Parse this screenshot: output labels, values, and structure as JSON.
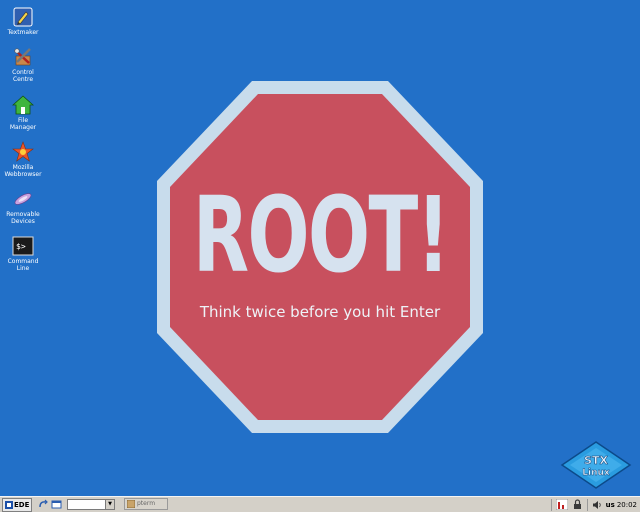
{
  "desktop": {
    "icons": [
      {
        "label": "Textmaker",
        "icon": "textmaker-icon"
      },
      {
        "label": "Control\nCentre",
        "icon": "control-centre-icon"
      },
      {
        "label": "File\nManager",
        "icon": "file-manager-icon"
      },
      {
        "label": "Mozilla\nWebbrowser",
        "icon": "mozilla-icon"
      },
      {
        "label": "Removable\nDevices",
        "icon": "removable-devices-icon"
      },
      {
        "label": "Command\nLine",
        "icon": "command-line-icon"
      }
    ]
  },
  "wallpaper": {
    "title": "ROOT!",
    "subtitle": "Think twice before you hit Enter",
    "logo_line1": "STX",
    "logo_line2": "Linux",
    "colors": {
      "background": "#2270c8",
      "sign_fill": "#c8505e",
      "sign_border": "#c8dcec"
    }
  },
  "taskbar": {
    "start_label": "EDE",
    "workspace_value": "",
    "task_label": "pterm",
    "keyboard_layout": "us",
    "clock": "20:02"
  }
}
